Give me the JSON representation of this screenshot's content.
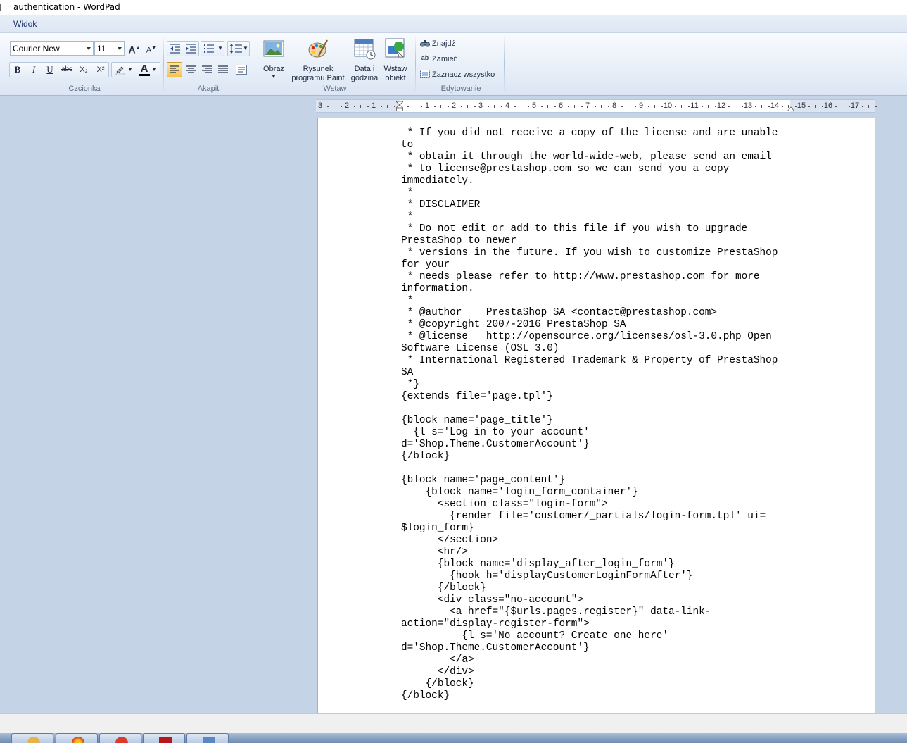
{
  "window": {
    "title": "authentication - WordPad"
  },
  "ribbon": {
    "tabs": [
      {
        "label": "Widok"
      }
    ],
    "font": {
      "family": "Courier New",
      "size": "11",
      "group_label": "Czcionka",
      "buttons": {
        "grow": "A",
        "shrink": "A",
        "bold": "B",
        "italic": "I",
        "underline": "U",
        "strike": "abc",
        "sub": "X₂",
        "sup": "X²",
        "color": "A"
      }
    },
    "paragraph": {
      "group_label": "Akapit"
    },
    "insert": {
      "group_label": "Wstaw",
      "picture_label": "Obraz",
      "paint_label_1": "Rysunek",
      "paint_label_2": "programu Paint",
      "datetime_label_1": "Data i",
      "datetime_label_2": "godzina",
      "object_label_1": "Wstaw",
      "object_label_2": "obiekt"
    },
    "editing": {
      "group_label": "Edytowanie",
      "find": "Znajdź",
      "replace": "Zamień",
      "select_all": "Zaznacz wszystko"
    }
  },
  "ruler": {
    "labels": [
      "3",
      "2",
      "1",
      "1",
      "2",
      "3",
      "4",
      "5",
      "6",
      "7",
      "8",
      "9",
      "10",
      "11",
      "12",
      "13",
      "14",
      "15",
      "16",
      "17"
    ]
  },
  "document": {
    "lines": [
      " * If you did not receive a copy of the license and are unable",
      "to",
      " * obtain it through the world-wide-web, please send an email",
      " * to license@prestashop.com so we can send you a copy",
      "immediately.",
      " *",
      " * DISCLAIMER",
      " *",
      " * Do not edit or add to this file if you wish to upgrade",
      "PrestaShop to newer",
      " * versions in the future. If you wish to customize PrestaShop",
      "for your",
      " * needs please refer to http://www.prestashop.com for more",
      "information.",
      " *",
      " * @author    PrestaShop SA <contact@prestashop.com>",
      " * @copyright 2007-2016 PrestaShop SA",
      " * @license   http://opensource.org/licenses/osl-3.0.php Open",
      "Software License (OSL 3.0)",
      " * International Registered Trademark & Property of PrestaShop",
      "SA",
      " *}",
      "{extends file='page.tpl'}",
      "",
      "{block name='page_title'}",
      "  {l s='Log in to your account'",
      "d='Shop.Theme.CustomerAccount'}",
      "{/block}",
      "",
      "{block name='page_content'}",
      "    {block name='login_form_container'}",
      "      <section class=\"login-form\">",
      "        {render file='customer/_partials/login-form.tpl' ui=",
      "$login_form}",
      "      </section>",
      "      <hr/>",
      "      {block name='display_after_login_form'}",
      "        {hook h='displayCustomerLoginFormAfter'}",
      "      {/block}",
      "      <div class=\"no-account\">",
      "        <a href=\"{$urls.pages.register}\" data-link-",
      "action=\"display-register-form\">",
      "          {l s='No account? Create one here'",
      "d='Shop.Theme.CustomerAccount'}",
      "        </a>",
      "      </div>",
      "    {/block}",
      "{/block}"
    ]
  },
  "colors": {
    "workspace": "#c5d3e6",
    "selected_button": "#f8c24f",
    "ribbon_text": "#15306b"
  }
}
